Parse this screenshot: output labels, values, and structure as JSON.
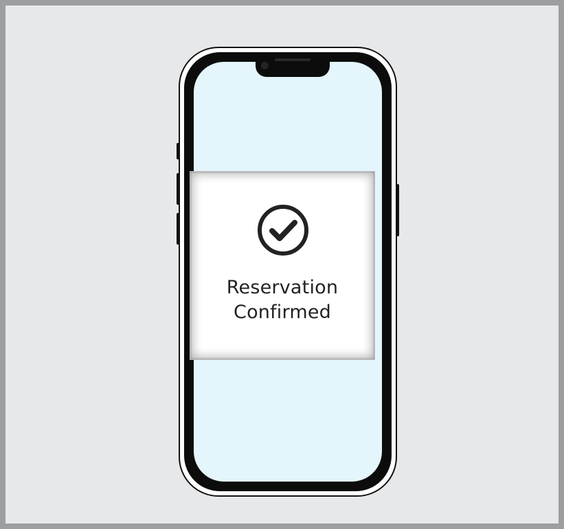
{
  "confirmation": {
    "line1": "Reservation",
    "line2": "Confirmed",
    "icon": "check-circle-icon"
  },
  "colors": {
    "frame_border": "#9c9ea2",
    "background": "#e7e8ea",
    "screen": "#e4f6fb",
    "card": "#ffffff",
    "text": "#222222"
  }
}
